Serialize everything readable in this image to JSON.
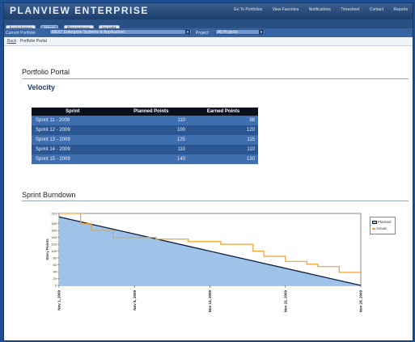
{
  "app": {
    "name": "PLANVIEW ENTERPRISE"
  },
  "top_links": [
    "Go To Portfolios",
    "View Favorites",
    "Notifications",
    "Timesheet",
    "Contact",
    "Reports"
  ],
  "tabs": [
    {
      "label": "Assistance",
      "active": false
    },
    {
      "label": "Work",
      "active": true
    },
    {
      "label": "Resources",
      "active": false
    },
    {
      "label": "Insight",
      "active": false
    }
  ],
  "filters": {
    "portfolio_label": "Current Portfolio:",
    "portfolio_value": "NEXT Enterprise Systems & Applications",
    "project_label": "Project:",
    "project_value": "All Projects"
  },
  "breadcrumb": {
    "link": "Back",
    "current": "Portfolio Portal"
  },
  "page_title": "Portfolio Portal",
  "velocity": {
    "title": "Velocity",
    "columns": [
      "Sprint",
      "Planned Points",
      "Earned Points"
    ],
    "rows": [
      {
        "sprint": "Sprint 11 - 2009",
        "planned": "110",
        "earned": "98"
      },
      {
        "sprint": "Sprint 12 - 2009",
        "planned": "100",
        "earned": "120"
      },
      {
        "sprint": "Sprint 13 - 2009",
        "planned": "125",
        "earned": "115"
      },
      {
        "sprint": "Sprint 14 - 2009",
        "planned": "110",
        "earned": "110"
      },
      {
        "sprint": "Sprint 15 - 2009",
        "planned": "140",
        "earned": "130"
      }
    ]
  },
  "burndown": {
    "title": "Sprint Burndown",
    "legend": [
      "Planned",
      "Actual"
    ]
  },
  "colors": {
    "planned_fill": "#9fc3e8",
    "planned_line": "#0a1a3a",
    "actual_line": "#f0a030"
  },
  "chart_data": {
    "type": "area",
    "title": "Sprint Burndown",
    "ylabel": "Story Points",
    "xlabel": "",
    "ylim": [
      0,
      210
    ],
    "yticks": [
      0,
      20,
      40,
      60,
      80,
      100,
      120,
      140,
      160,
      180,
      210
    ],
    "xlim": [
      0,
      28
    ],
    "xtick_labels": [
      {
        "x": 0,
        "label": "Nov 1, 2009"
      },
      {
        "x": 7,
        "label": "Nov 8, 2009"
      },
      {
        "x": 14,
        "label": "Nov 15, 2009"
      },
      {
        "x": 21,
        "label": "Nov 22, 2009"
      },
      {
        "x": 28,
        "label": "Nov 29, 2009"
      }
    ],
    "grid": false,
    "legend_position": "right",
    "series": [
      {
        "name": "Planned",
        "x": [
          0,
          28
        ],
        "y": [
          200,
          0
        ]
      },
      {
        "name": "Actual",
        "x": [
          0,
          2,
          2,
          3,
          3,
          5,
          5,
          9,
          9,
          12,
          12,
          15,
          15,
          18,
          18,
          19,
          19,
          21,
          21,
          23,
          23,
          24,
          24,
          26,
          26,
          28
        ],
        "y": [
          210,
          210,
          180,
          180,
          160,
          160,
          140,
          140,
          135,
          135,
          128,
          128,
          120,
          120,
          100,
          100,
          85,
          85,
          70,
          70,
          62,
          62,
          55,
          55,
          38,
          38
        ]
      }
    ]
  }
}
